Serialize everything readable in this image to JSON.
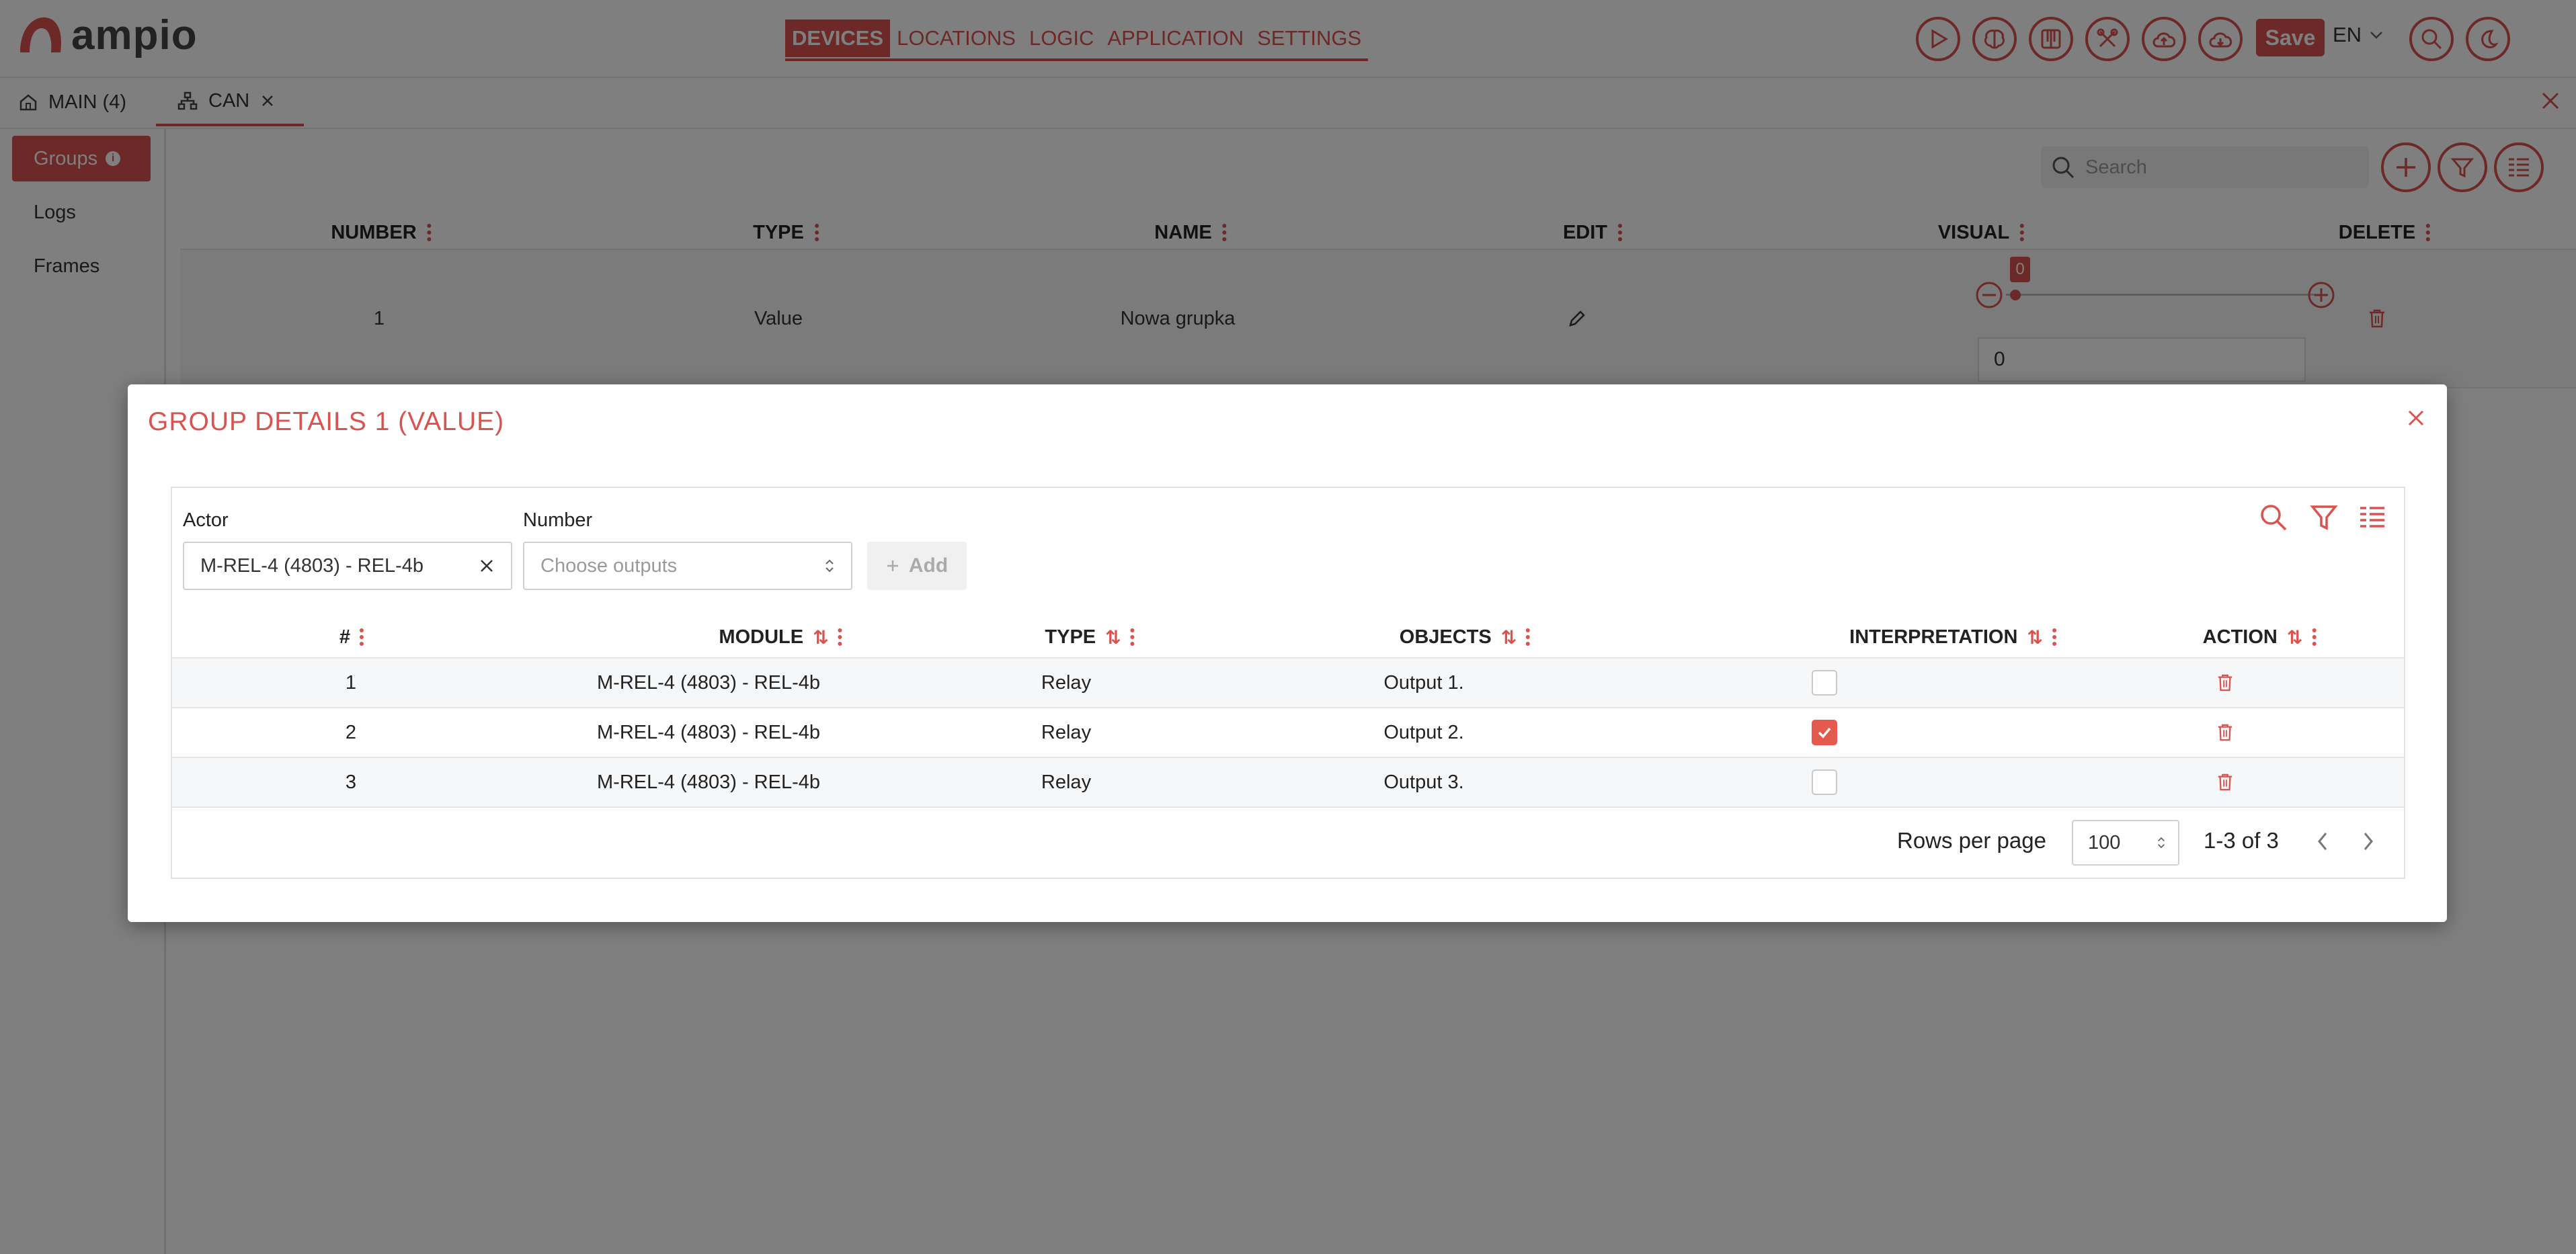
{
  "app": {
    "logo_text": "ampio",
    "brand_color": "#d9534f"
  },
  "nav": {
    "items": [
      {
        "label": "DEVICES",
        "active": true
      },
      {
        "label": "LOCATIONS",
        "active": false
      },
      {
        "label": "LOGIC",
        "active": false
      },
      {
        "label": "APPLICATION",
        "active": false
      },
      {
        "label": "SETTINGS",
        "active": false
      }
    ]
  },
  "toolbar": {
    "icons": [
      "play-icon",
      "brain-icon",
      "keyboard-icon",
      "tools-icon",
      "cloud-upload-icon",
      "cloud-download-icon"
    ],
    "save_label": "Save",
    "language": "EN",
    "right_icons": [
      "search-icon",
      "moon-icon"
    ]
  },
  "tabs": [
    {
      "label": "MAIN (4)",
      "icon": "home-icon",
      "active": false
    },
    {
      "label": "CAN",
      "icon": "network-icon",
      "active": true
    }
  ],
  "sidebar": {
    "items": [
      {
        "label": "Groups",
        "active": true
      },
      {
        "label": "Logs",
        "active": false
      },
      {
        "label": "Frames",
        "active": false
      }
    ]
  },
  "main": {
    "search_placeholder": "Search",
    "columns": [
      "NUMBER",
      "TYPE",
      "NAME",
      "EDIT",
      "VISUAL",
      "DELETE"
    ],
    "row": {
      "number": "1",
      "type": "Value",
      "name": "Nowa grupka",
      "slider_value": "0",
      "input_value": "0"
    }
  },
  "dialog": {
    "title": "GROUP DETAILS 1 (VALUE)",
    "actor_label": "Actor",
    "actor_value": "M-REL-4 (4803) - REL-4b",
    "number_label": "Number",
    "number_placeholder": "Choose outputs",
    "add_label": "Add",
    "columns": [
      "#",
      "MODULE",
      "TYPE",
      "OBJECTS",
      "INTERPRETATION",
      "ACTION"
    ],
    "rows": [
      {
        "n": "1",
        "module": "M-REL-4 (4803) - REL-4b",
        "type": "Relay",
        "objects": "Output 1.",
        "checked": false
      },
      {
        "n": "2",
        "module": "M-REL-4 (4803) - REL-4b",
        "type": "Relay",
        "objects": "Output 2.",
        "checked": true
      },
      {
        "n": "3",
        "module": "M-REL-4 (4803) - REL-4b",
        "type": "Relay",
        "objects": "Output 3.",
        "checked": false
      }
    ],
    "rows_per_page_label": "Rows per page",
    "rows_per_page_value": "100",
    "range_text": "1-3 of 3"
  }
}
